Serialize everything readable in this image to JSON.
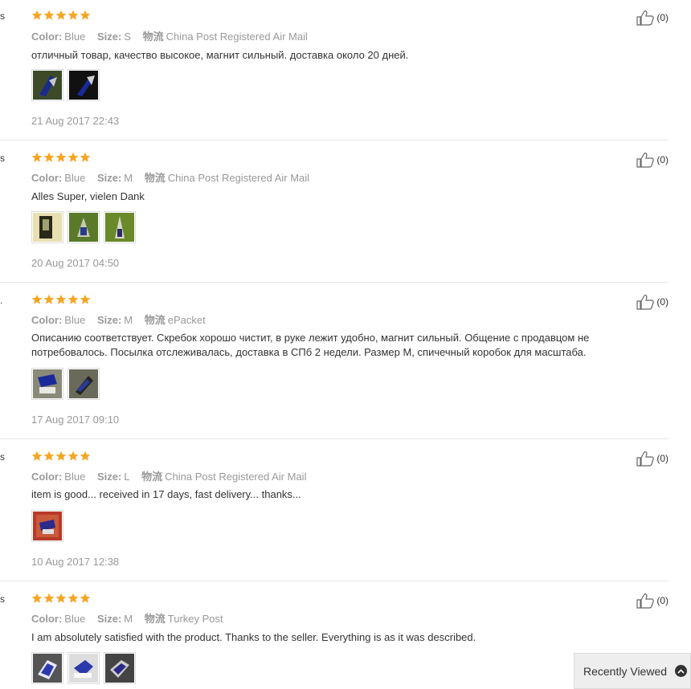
{
  "colors": {
    "star": "#f5a623",
    "text": "#333333",
    "muted": "#999999",
    "divider": "#e8e8e8"
  },
  "reviews": [
    {
      "edge": "s",
      "stars": 5,
      "color_label": "Color:",
      "color": "Blue",
      "size_label": "Size:",
      "size": "S",
      "ship_label": "物流",
      "shipping": "China Post Registered Air Mail",
      "text": "отличный товар, качество высокое, магнит сильный. доставка около 20 дней.",
      "photos": [
        "photo-1",
        "photo-2"
      ],
      "date": "21 Aug 2017 22:43",
      "likes": "(0)"
    },
    {
      "edge": "s",
      "stars": 5,
      "color_label": "Color:",
      "color": "Blue",
      "size_label": "Size:",
      "size": "M",
      "ship_label": "物流",
      "shipping": "China Post Registered Air Mail",
      "text": "Alles Super, vielen Dank",
      "photos": [
        "photo-1",
        "photo-2",
        "photo-3"
      ],
      "date": "20 Aug 2017 04:50",
      "likes": "(0)"
    },
    {
      "edge": ".",
      "stars": 5,
      "color_label": "Color:",
      "color": "Blue",
      "size_label": "Size:",
      "size": "M",
      "ship_label": "物流",
      "shipping": "ePacket",
      "text": "Описанию соответствует. Скребок хорошо чистит, в руке лежит удобно, магнит сильный. Общение с продавцом не потребовалось. Посылка отслеживалась, доставка в СПб 2 недели. Размер М, спичечный коробок для масштаба.",
      "photos": [
        "photo-1",
        "photo-2"
      ],
      "date": "17 Aug 2017 09:10",
      "likes": "(0)"
    },
    {
      "edge": "s",
      "stars": 5,
      "color_label": "Color:",
      "color": "Blue",
      "size_label": "Size:",
      "size": "L",
      "ship_label": "物流",
      "shipping": "China Post Registered Air Mail",
      "text": "item is good... received in 17 days, fast delivery... thanks...",
      "photos": [
        "photo-1"
      ],
      "date": "10 Aug 2017 12:38",
      "likes": "(0)"
    },
    {
      "edge": "s",
      "stars": 5,
      "color_label": "Color:",
      "color": "Blue",
      "size_label": "Size:",
      "size": "M",
      "ship_label": "物流",
      "shipping": "Turkey Post",
      "text": "I am absolutely satisfied with the product. Thanks to the seller. Everything is as it was described.",
      "photos": [
        "photo-1",
        "photo-2",
        "photo-3"
      ],
      "date": "",
      "likes": "(0)"
    }
  ],
  "recently_viewed": {
    "label": "Recently Viewed",
    "icon": "chevron-up-icon"
  }
}
